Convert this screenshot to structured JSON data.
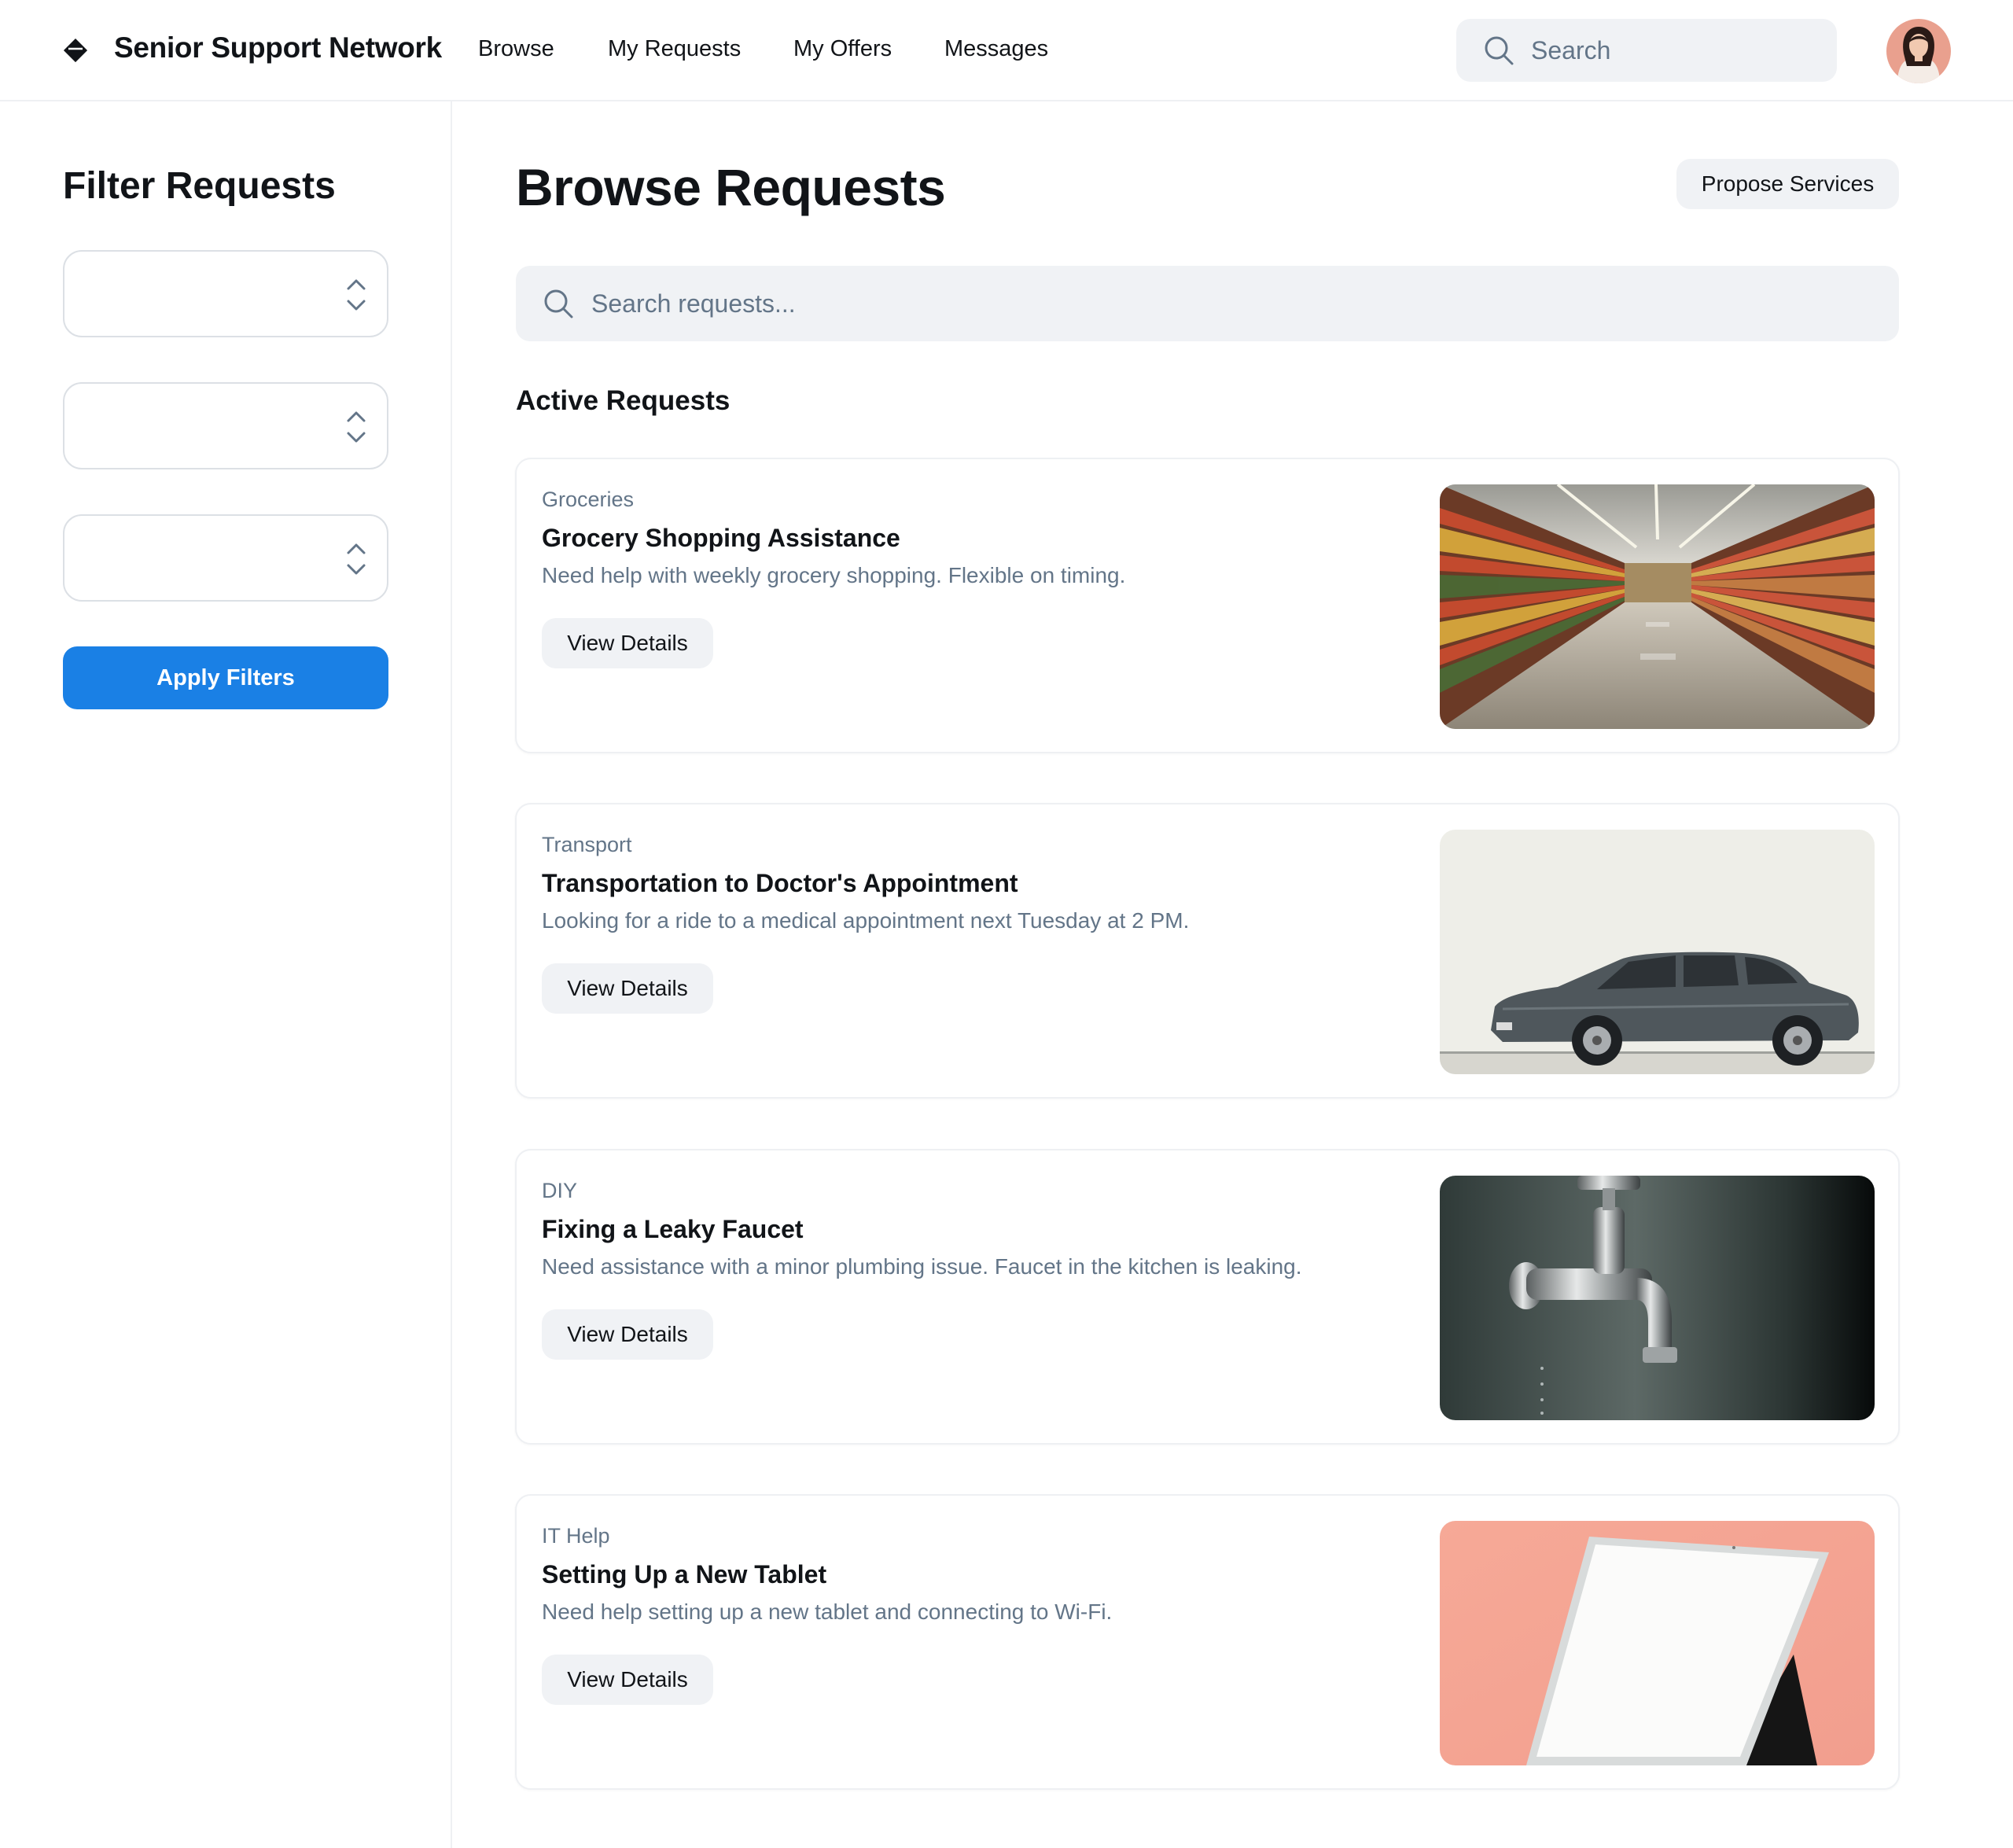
{
  "header": {
    "brand": "Senior Support Network",
    "nav": [
      {
        "label": "Browse"
      },
      {
        "label": "My Requests"
      },
      {
        "label": "My Offers"
      },
      {
        "label": "Messages"
      }
    ],
    "search_placeholder": "Search"
  },
  "sidebar": {
    "title": "Filter Requests",
    "filters": [
      {
        "value": ""
      },
      {
        "value": ""
      },
      {
        "value": ""
      }
    ],
    "apply_label": "Apply Filters"
  },
  "main": {
    "title": "Browse Requests",
    "propose_label": "Propose Services",
    "search_placeholder": "Search requests...",
    "section_title": "Active Requests",
    "requests": [
      {
        "category": "Groceries",
        "title": "Grocery Shopping Assistance",
        "description": "Need help with weekly grocery shopping. Flexible on timing.",
        "button": "View Details",
        "image": "grocery-aisle-photo"
      },
      {
        "category": "Transport",
        "title": "Transportation to Doctor's Appointment",
        "description": "Looking for a ride to a medical appointment next Tuesday at 2 PM.",
        "button": "View Details",
        "image": "car-photo"
      },
      {
        "category": "DIY",
        "title": "Fixing a Leaky Faucet",
        "description": "Need assistance with a minor plumbing issue. Faucet in the kitchen is leaking.",
        "button": "View Details",
        "image": "faucet-photo"
      },
      {
        "category": "IT Help",
        "title": "Setting Up a New Tablet",
        "description": "Need help setting up a new tablet and connecting to Wi-Fi.",
        "button": "View Details",
        "image": "tablet-photo"
      }
    ]
  },
  "colors": {
    "primary": "#1a80e5",
    "muted_text": "#637588",
    "surface": "#f0f2f5",
    "border": "#dce0e5"
  }
}
